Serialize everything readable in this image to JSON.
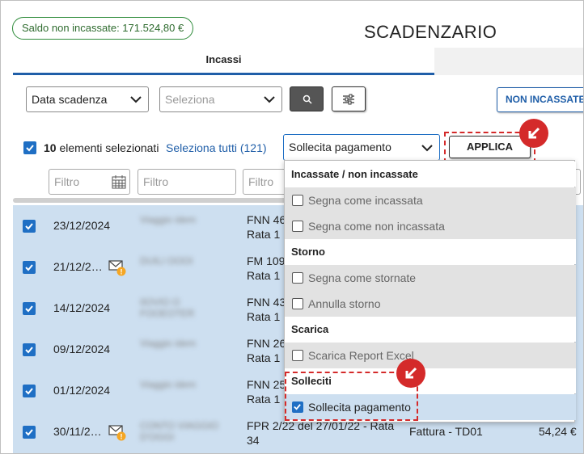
{
  "header": {
    "saldo": "Saldo non incassate: 171.524,80 €",
    "title": "SCADENZARIO"
  },
  "tabs": [
    {
      "label": "Incassi",
      "active": true
    }
  ],
  "toolbar": {
    "date_select": "Data scadenza",
    "seleziona_placeholder": "Seleziona",
    "non_incassate_label": "NON INCASSATE"
  },
  "selection": {
    "count": "10",
    "label": "elementi selezionati",
    "select_all": "Seleziona tutti (121)",
    "action_value": "Sollecita pagamento",
    "apply_label": "APPLICA"
  },
  "filters": [
    "Filtro",
    "Filtro",
    "Filtro"
  ],
  "dropdown": {
    "groups": [
      {
        "header": "Incassate / non incassate",
        "items": [
          {
            "label": "Segna come incassata",
            "checked": false
          },
          {
            "label": "Segna come non incassata",
            "checked": false
          }
        ]
      },
      {
        "header": "Storno",
        "items": [
          {
            "label": "Segna come stornate",
            "checked": false
          },
          {
            "label": "Annulla storno",
            "checked": false
          }
        ]
      },
      {
        "header": "Scarica",
        "items": [
          {
            "label": "Scarica Report Excel",
            "checked": false
          }
        ]
      },
      {
        "header": "Solleciti",
        "items": [
          {
            "label": "Sollecita pagamento",
            "checked": true
          }
        ]
      }
    ]
  },
  "rows": [
    {
      "date": "23/12/2024",
      "client": "Viaggio idem",
      "doc1": "FNN 46",
      "doc2": "Rata 1",
      "mail": false
    },
    {
      "date": "21/12/2…",
      "client": "DUILI OOOI",
      "doc1": "FM 109",
      "doc2": "Rata 1",
      "mail": true
    },
    {
      "date": "14/12/2024",
      "client": "0OVIO O FOOEOTER",
      "doc1": "FNN 43",
      "doc2": "Rata 1",
      "mail": false
    },
    {
      "date": "09/12/2024",
      "client": "Viaggio idem",
      "doc1": "FNN 26",
      "doc2": "Rata 1",
      "mail": false
    },
    {
      "date": "01/12/2024",
      "client": "Viaggio idem",
      "doc1": "FNN 25",
      "doc2": "Rata 1",
      "mail": false
    },
    {
      "date": "30/11/2…",
      "client": "CONTO VIAGGIO D'OGGI",
      "doc1": "FPR 2/22 del 27/01/22 - Rata",
      "doc2": "34",
      "mail": true,
      "tipo": "Fattura - TD01",
      "importo": "54,24 €"
    }
  ],
  "colors": {
    "accent": "#1f6fc4",
    "annotation": "#d42a2a",
    "selected_row": "#cddff0"
  }
}
